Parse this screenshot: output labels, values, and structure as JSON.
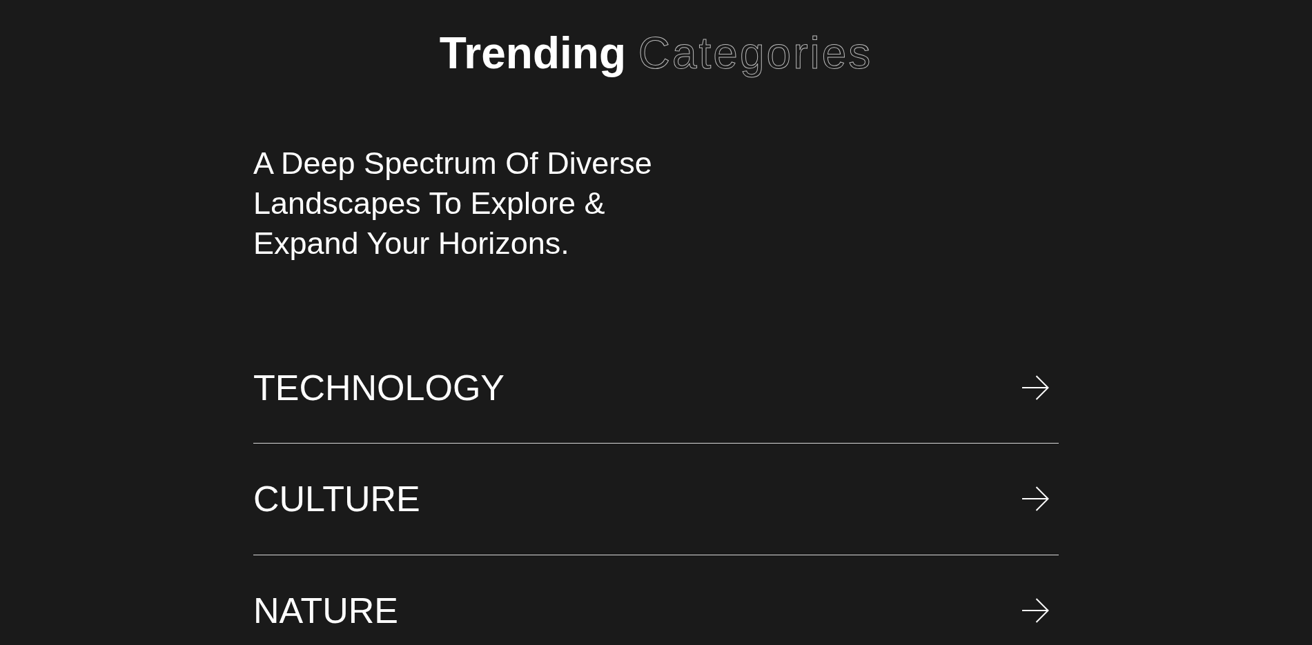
{
  "title": {
    "solid": "Trending",
    "outline": "Categories"
  },
  "intro": "A Deep Spectrum Of Diverse Landscapes To Explore & Expand Your Horizons.",
  "categories": [
    {
      "label": "TECHNOLOGY"
    },
    {
      "label": "CULTURE"
    },
    {
      "label": "NATURE"
    }
  ]
}
